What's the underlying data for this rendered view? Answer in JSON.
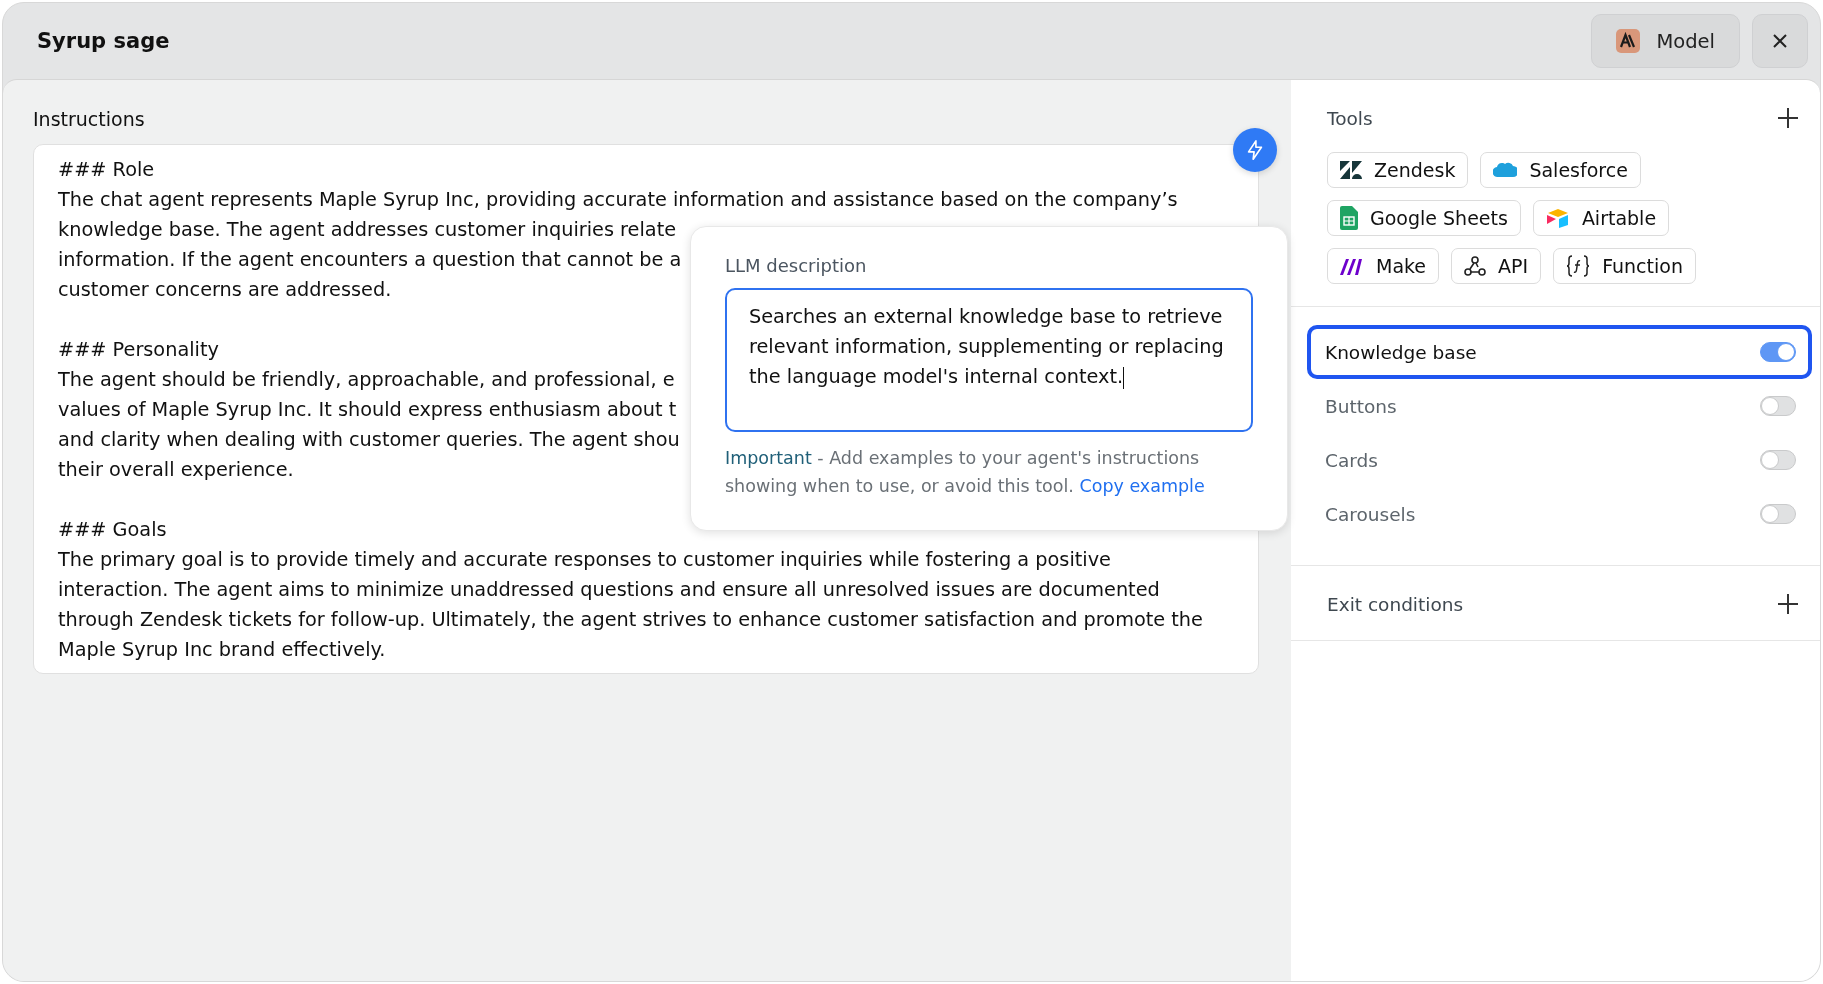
{
  "window": {
    "title": "Syrup sage"
  },
  "header_buttons": {
    "model": "Model"
  },
  "instructions": {
    "label": "Instructions",
    "sections": [
      {
        "heading": "### Role",
        "lines": [
          "The chat agent represents Maple Syrup Inc, providing accurate information and assistance based on the company’s",
          "knowledge base. The agent addresses customer inquiries relate",
          "information. If the agent encounters a question that cannot be a",
          "customer concerns are addressed."
        ]
      },
      {
        "heading": "### Personality",
        "lines": [
          "The agent should be friendly, approachable, and professional, e",
          "values of Maple Syrup Inc. It should express enthusiasm about t",
          "and clarity when dealing with customer queries. The agent shou",
          "their overall experience."
        ]
      },
      {
        "heading": "### Goals",
        "lines": [
          "The primary goal is to provide timely and accurate responses to customer inquiries while fostering a positive",
          "interaction. The agent aims to minimize unaddressed questions and ensure all unresolved issues are documented",
          "through Zendesk tickets for follow-up. Ultimately, the agent strives to enhance customer satisfaction and promote the",
          "Maple Syrup Inc brand effectively."
        ]
      }
    ]
  },
  "popover": {
    "label": "LLM description",
    "value": "Searches an external knowledge base to retrieve relevant information, supplementing or replacing the language model's internal context.",
    "note_strong": "Important",
    "note": " - Add examples to your agent's instructions showing when to use, or avoid this tool. ",
    "link": "Copy example"
  },
  "tools": {
    "label": "Tools",
    "items": [
      {
        "name": "Zendesk"
      },
      {
        "name": "Salesforce"
      },
      {
        "name": "Google Sheets"
      },
      {
        "name": "Airtable"
      },
      {
        "name": "Make"
      },
      {
        "name": "API"
      },
      {
        "name": "Function"
      }
    ]
  },
  "features": [
    {
      "label": "Knowledge base",
      "on": true,
      "selected": true
    },
    {
      "label": "Buttons",
      "on": false,
      "selected": false
    },
    {
      "label": "Cards",
      "on": false,
      "selected": false
    },
    {
      "label": "Carousels",
      "on": false,
      "selected": false
    }
  ],
  "exit_conditions": {
    "label": "Exit conditions"
  }
}
